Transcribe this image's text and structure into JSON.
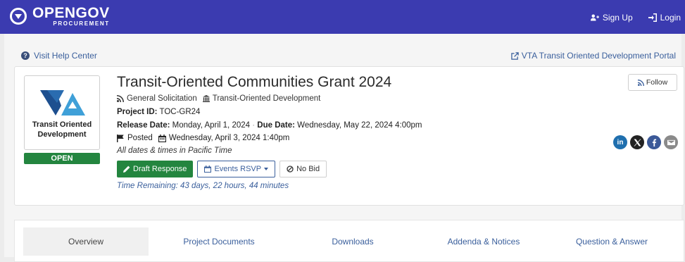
{
  "header": {
    "brand": "OPENGOV",
    "brand_sub": "PROCUREMENT",
    "sign_up": "Sign Up",
    "login": "Login"
  },
  "links": {
    "help": "Visit Help Center",
    "portal": "VTA Transit Oriented Development Portal"
  },
  "project": {
    "title": "Transit-Oriented Communities Grant 2024",
    "type": "General Solicitation",
    "department": "Transit-Oriented Development",
    "project_id_label": "Project ID:",
    "project_id": "TOC-GR24",
    "release_label": "Release Date:",
    "release_date": "Monday, April 1, 2024",
    "due_label": "Due Date:",
    "due_date": "Wednesday, May 22, 2024 4:00pm",
    "posted_label": "Posted",
    "posted_date": "Wednesday, April 3, 2024 1:40pm",
    "tz_note": "All dates & times in Pacific Time",
    "time_remaining": "Time Remaining: 43 days, 22 hours, 44 minutes",
    "status": "OPEN",
    "logo_caption_1": "Transit Oriented",
    "logo_caption_2": "Development"
  },
  "buttons": {
    "draft": "Draft Response",
    "events": "Events RSVP",
    "no_bid": "No Bid",
    "follow": "Follow"
  },
  "social": {
    "linkedin": "in"
  },
  "tabs": [
    {
      "label": "Overview"
    },
    {
      "label": "Project Documents"
    },
    {
      "label": "Downloads"
    },
    {
      "label": "Addenda & Notices"
    },
    {
      "label": "Question & Answer"
    }
  ],
  "colors": {
    "nav": "#3b3bb0",
    "accent_green": "#23853f",
    "link_blue": "#3a5f9c",
    "vta_dark": "#1d4f8f",
    "vta_light": "#3fa0d8"
  },
  "icons": [
    "logo-icon",
    "user-plus-icon",
    "sign-in-icon",
    "question-icon",
    "external-link-icon",
    "rss-icon",
    "bank-icon",
    "flag-icon",
    "calendar-icon",
    "pencil-icon",
    "ban-icon",
    "linkedin-icon",
    "x-icon",
    "facebook-icon",
    "envelope-icon"
  ]
}
